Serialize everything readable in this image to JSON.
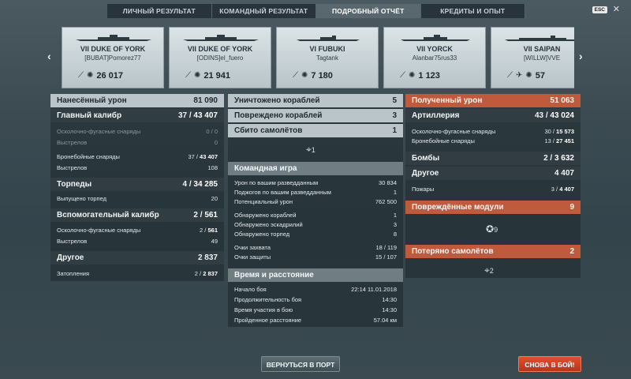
{
  "tabs": [
    "ЛИЧНЫЙ РЕЗУЛЬТАТ",
    "КОМАНДНЫЙ РЕЗУЛЬТАТ",
    "ПОДРОБНЫЙ ОТЧЁТ",
    "КРЕДИТЫ И ОПЫТ"
  ],
  "esc_label": "ESC",
  "cards": [
    {
      "ship": "VII DUKE OF YORK",
      "player": "[BUBAT]Pomorez77",
      "value": "26 017"
    },
    {
      "ship": "VII DUKE OF YORK",
      "player": "[ODINS]el_fuero",
      "value": "21 941"
    },
    {
      "ship": "VI FUBUKI",
      "player": "Tagtank",
      "value": "7 180"
    },
    {
      "ship": "VII YORCK",
      "player": "Alanbar75rus33",
      "value": "1 123"
    },
    {
      "ship": "VII SAIPAN",
      "player": "[WILLW]VVE",
      "value": "57"
    }
  ],
  "left": {
    "dealt": {
      "label": "Нанесённый урон",
      "value": "81 090"
    },
    "main": {
      "label": "Главный калибр",
      "a": "37",
      "b": "43 407"
    },
    "he": {
      "label": "Осколочно-фугасные снаряды",
      "value": "0 / 0"
    },
    "he_shots": {
      "label": "Выстрелов",
      "value": "0"
    },
    "ap": {
      "label": "Бронебойные снаряды",
      "a": "37",
      "b": "43 407"
    },
    "ap_shots": {
      "label": "Выстрелов",
      "value": "108"
    },
    "torp": {
      "label": "Торпеды",
      "a": "4",
      "b": "34 285"
    },
    "torp_launched": {
      "label": "Выпущено торпед",
      "value": "20"
    },
    "sec": {
      "label": "Вспомогательный калибр",
      "a": "2",
      "b": "561"
    },
    "sec_he": {
      "label": "Осколочно-фугасные снаряды",
      "a": "2",
      "b": "561"
    },
    "sec_shots": {
      "label": "Выстрелов",
      "value": "49"
    },
    "other": {
      "label": "Другое",
      "value": "2 837"
    },
    "flood": {
      "label": "Затопления",
      "a": "2",
      "b": "2 837"
    }
  },
  "center": {
    "destroyed": {
      "label": "Уничтожено кораблей",
      "value": "5"
    },
    "damaged": {
      "label": "Повреждено кораблей",
      "value": "3"
    },
    "planes": {
      "label": "Сбито самолётов",
      "value": "1"
    },
    "planes_icon_count": "1",
    "team": "Командная игра",
    "team_rows": [
      {
        "label": "Урон по вашим разведданным",
        "value": "30 834"
      },
      {
        "label": "Поджогов по вашим разведданным",
        "value": "1"
      },
      {
        "label": "Потенциальный урон",
        "value": "762 500"
      },
      {
        "label": "Обнаружено кораблей",
        "value": "1"
      },
      {
        "label": "Обнаружено эскадрилий",
        "value": "3"
      },
      {
        "label": "Обнаружено торпед",
        "value": "8"
      },
      {
        "label": "Очки захвата",
        "value": "18 / 119"
      },
      {
        "label": "Очки защиты",
        "value": "15 / 107"
      }
    ],
    "time": "Время и расстояние",
    "time_rows": [
      {
        "label": "Начало боя",
        "value": "22:14  11.01.2018"
      },
      {
        "label": "Продолжительность боя",
        "value": "14:30"
      },
      {
        "label": "Время участия в бою",
        "value": "14:30"
      },
      {
        "label": "Пройденное расстояние",
        "value": "57.04 км"
      }
    ]
  },
  "right": {
    "received": {
      "label": "Полученный урон",
      "value": "51 063"
    },
    "art": {
      "label": "Артиллерия",
      "a": "43",
      "b": "43 024"
    },
    "he": {
      "label": "Осколочно-фугасные снаряды",
      "a": "30",
      "b": "15 573"
    },
    "ap": {
      "label": "Бронебойные снаряды",
      "a": "13",
      "b": "27 451"
    },
    "bombs": {
      "label": "Бомбы",
      "a": "2",
      "b": "3 632"
    },
    "other": {
      "label": "Другое",
      "value": "4 407"
    },
    "fires": {
      "label": "Пожары",
      "a": "3",
      "b": "4 407"
    },
    "modules": {
      "label": "Повреждённые модули",
      "value": "9"
    },
    "modules_icon_count": "9",
    "lost_planes": {
      "label": "Потеряно самолётов",
      "value": "2"
    },
    "lost_planes_icon_count": "2"
  },
  "buttons": {
    "port": "ВЕРНУТЬСЯ В ПОРТ",
    "battle": "СНОВА В БОЙ!"
  }
}
